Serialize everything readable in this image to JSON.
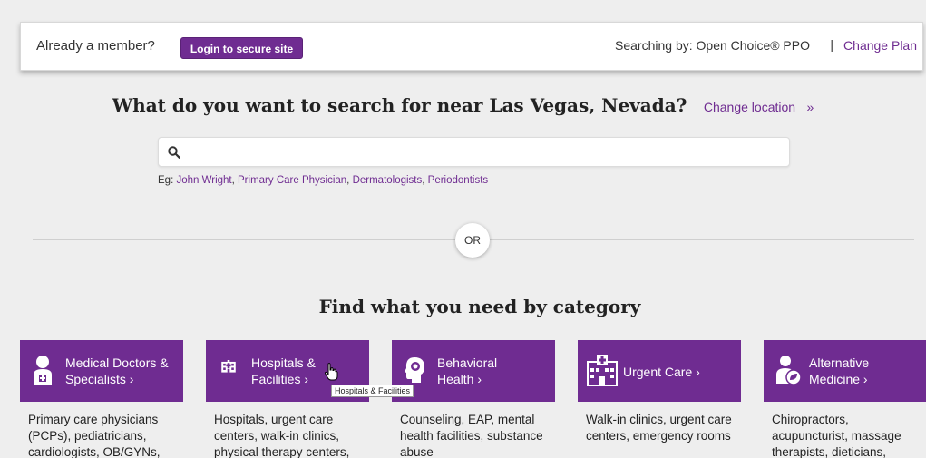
{
  "topbar": {
    "member_prompt": "Already a member?",
    "login_label": "Login to secure site",
    "searching_by": "Searching by: Open Choice® PPO",
    "separator": "|",
    "change_plan": "Change Plan"
  },
  "search": {
    "question": "What do you want to search for near Las Vegas, Nevada?",
    "change_location": "Change location",
    "chevron": "»",
    "input_value": "",
    "placeholder": "",
    "examples_prefix": "Eg:",
    "examples": [
      "John Wright",
      "Primary Care Physician",
      "Dermatologists",
      "Periodontists"
    ]
  },
  "or_label": "OR",
  "category_title": "Find what you need by category",
  "categories": [
    {
      "label_line1": "Medical Doctors &",
      "label_line2": "Specialists ›",
      "icon": "doctor-icon",
      "description": "Primary care physicians (PCPs), pediatricians, cardiologists, OB/GYNs,"
    },
    {
      "label_line1": "Hospitals &",
      "label_line2": "Facilities ›",
      "icon": "hospital-icon",
      "description": "Hospitals, urgent care centers, walk-in clinics, physical therapy centers,"
    },
    {
      "label_line1": "Behavioral",
      "label_line2": "Health ›",
      "icon": "head-icon",
      "description": "Counseling, EAP, mental health facilities, substance abuse"
    },
    {
      "label_line1": "Urgent Care ›",
      "label_line2": "",
      "icon": "urgent-care-building-icon",
      "description": "Walk-in clinics, urgent care centers, emergency rooms"
    },
    {
      "label_line1": "Alternative",
      "label_line2": "Medicine ›",
      "icon": "alt-medicine-icon",
      "description": "Chiropractors, acupuncturist, massage therapists, dieticians,"
    }
  ],
  "tooltip": "Hospitals & Facilities",
  "colors": {
    "brand_purple": "#6f2c91",
    "background": "#eeeeee"
  }
}
